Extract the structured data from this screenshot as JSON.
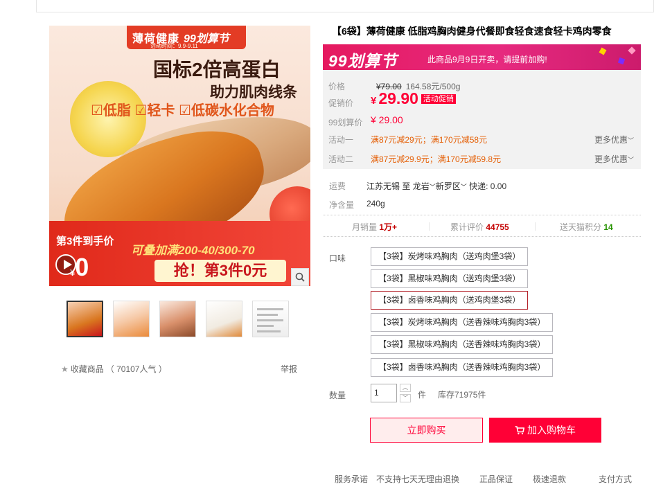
{
  "title": "【6袋】薄荷健康 低脂鸡胸肉健身代餐即食轻食速食轻卡鸡肉零食",
  "main_image": {
    "brand_name": "薄荷健康",
    "brand_event": "99划算节",
    "event_time": "活动时间：9.9-9.11",
    "headline": "国标2倍高蛋白",
    "subline": "助力肌肉线条",
    "tags": "☑低脂 ☑轻卡 ☑低碳水化合物",
    "promo_line1": "第3件到手价",
    "promo_line2": "可叠加满200-40/300-70",
    "promo_price_symbol": "¥",
    "promo_price": "0",
    "promo_grab": "抢！第3件0元"
  },
  "gallery": {
    "favorite_label": "收藏商品",
    "favorite_count": "（ 70107人气 ）",
    "report_label": "举报"
  },
  "banner": {
    "event_name": "99划算节",
    "message": "此商品9月9日开卖，请提前加购!"
  },
  "price": {
    "price_label": "价格",
    "original_price": "¥79.00",
    "unit_price": "164.58元/500g",
    "promo_label": "促销价",
    "yen": "¥",
    "promo_price": "29.90",
    "promo_badge": "活动促销",
    "event_label": "99划算价",
    "event_price": "¥ 29.00",
    "activity1_label": "活动一",
    "activity1_text": "满87元减29元；满170元减58元",
    "activity2_label": "活动二",
    "activity2_text": "满87元减29.9元；满170元减59.8元",
    "more_label": "更多优惠"
  },
  "shipping": {
    "label": "运费",
    "from": "江苏无锡",
    "to_word": "至",
    "dest1": "龙岩",
    "dest2": "新罗区",
    "express": "快递: 0.00"
  },
  "net_weight": {
    "label": "净含量",
    "value": "240g"
  },
  "stats": {
    "sales_label": "月销量",
    "sales_value": "1万+",
    "reviews_label": "累计评价",
    "reviews_value": "44755",
    "points_label": "送天猫积分",
    "points_value": "14"
  },
  "sku": {
    "label": "口味",
    "options": [
      "【3袋】炭烤味鸡胸肉（送鸡肉堡3袋）",
      "【3袋】黑椒味鸡胸肉（送鸡肉堡3袋）",
      "【3袋】卤香味鸡胸肉（送鸡肉堡3袋）",
      "【3袋】炭烤味鸡胸肉（送香辣味鸡胸肉3袋）",
      "【3袋】黑椒味鸡胸肉（送香辣味鸡胸肉3袋）",
      "【3袋】卤香味鸡胸肉（送香辣味鸡胸肉3袋）"
    ],
    "selected_index": 2
  },
  "quantity": {
    "label": "数量",
    "value": "1",
    "unit": "件",
    "stock": "库存71975件"
  },
  "actions": {
    "buy_now": "立即购买",
    "add_to_cart": "加入购物车"
  },
  "promise": {
    "label": "服务承诺",
    "items": [
      "不支持七天无理由退换",
      "正品保证",
      "极速退款",
      "支付方式"
    ]
  },
  "colors": {
    "accent": "#ff0036",
    "banner": "#e5195f",
    "activity": "#e56007",
    "selected_border": "#b4242c"
  }
}
